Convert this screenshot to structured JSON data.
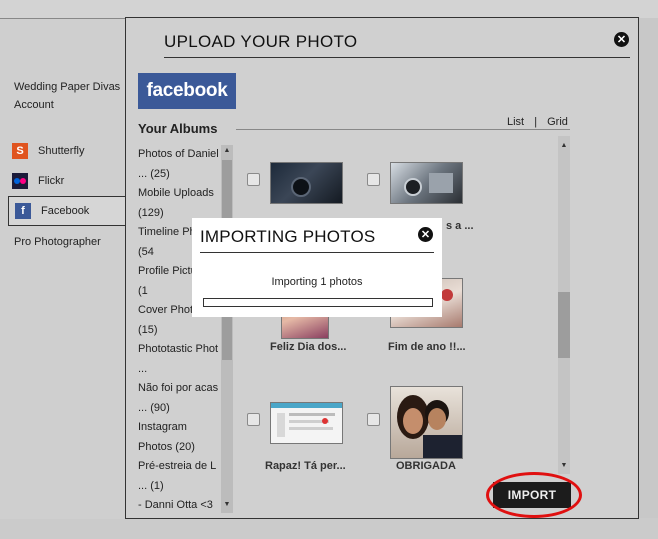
{
  "modal": {
    "title": "UPLOAD YOUR PHOTO",
    "close_glyph": "✕"
  },
  "sidebar": {
    "account_label": "Wedding Paper Divas Account",
    "items": [
      {
        "label": "Shutterfly",
        "icon": "shutterfly-icon",
        "color": "#e0541f"
      },
      {
        "label": "Flickr",
        "icon": "flickr-icon",
        "color": "#0063dc"
      },
      {
        "label": "Facebook",
        "icon": "facebook-icon",
        "color": "#3b5998"
      }
    ],
    "pro_label": "Pro Photographer"
  },
  "facebook": {
    "logo_text": "facebook",
    "albums_title": "Your Albums",
    "albums": [
      "Photos of Daniel ... (25)",
      "Mobile Uploads (129)",
      "Timeline Photos (54",
      "Profile Pictures (1",
      "Cover Photos (15)",
      "Phototastic Phot ...",
      "Não foi por acas ... (90)",
      "Instagram Photos (20)",
      "Pré-estreia de L ... (1)",
      "- Danni Otta <3"
    ]
  },
  "view": {
    "list_label": "List",
    "separator": "|",
    "grid_label": "Grid"
  },
  "photos": [
    {
      "caption": ""
    },
    {
      "caption": "s a ..."
    },
    {
      "caption": "Feliz Dia dos..."
    },
    {
      "caption": "Fim de ano !!..."
    },
    {
      "caption": "Rapaz! Tá per..."
    },
    {
      "caption": "OBRIGADA"
    }
  ],
  "import_button": "IMPORT",
  "importing_dialog": {
    "title": "IMPORTING PHOTOS",
    "status": "Importing 1 photos",
    "progress": 0
  },
  "colors": {
    "accent": "#3b5998",
    "highlight_ring": "#e01010"
  }
}
